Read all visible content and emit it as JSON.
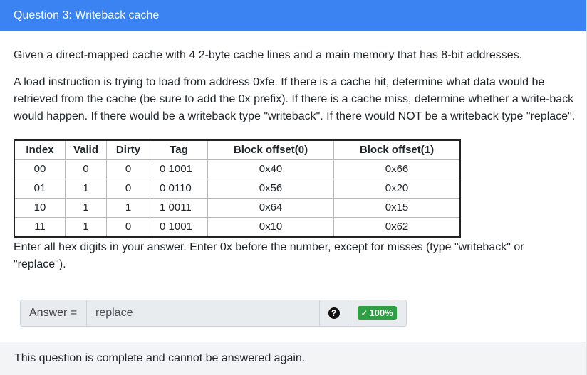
{
  "header": {
    "title": "Question 3: Writeback cache"
  },
  "question": {
    "intro": "Given a direct-mapped cache with 4 2-byte cache lines and a main memory that has 8-bit addresses.",
    "prompt": "A load instruction is trying to load from address 0xfe. If there is a cache hit, determine what data would be retrieved from the cache (be sure to add the 0x prefix). If there is a cache miss, determine whether a write-back would happen. If there would be a writeback type \"writeback\". If there would NOT be a writeback type \"replace\".",
    "instructions": "Enter all hex digits in your answer. Enter 0x before the number, except for misses (type \"writeback\" or \"replace\")."
  },
  "cache_table": {
    "headers": [
      "Index",
      "Valid",
      "Dirty",
      "Tag",
      "Block offset(0)",
      "Block offset(1)"
    ],
    "rows": [
      [
        "00",
        "0",
        "0",
        "0 1001",
        "0x40",
        "0x66"
      ],
      [
        "01",
        "1",
        "0",
        "0 0110",
        "0x56",
        "0x20"
      ],
      [
        "10",
        "1",
        "1",
        "1 0011",
        "0x64",
        "0x15"
      ],
      [
        "11",
        "1",
        "0",
        "0 1001",
        "0x10",
        "0x62"
      ]
    ]
  },
  "answer": {
    "label": "Answer =",
    "value": "replace",
    "help_icon": "question-circle-icon",
    "help_glyph": "?",
    "score_icon": "check-icon",
    "score_glyph": "✓",
    "score": "100%",
    "score_color": "#2f9e44"
  },
  "footer": {
    "status": "This question is complete and cannot be answered again."
  },
  "colors": {
    "header_bg": "#3b82f2",
    "footer_bg": "#f3f4f6"
  }
}
